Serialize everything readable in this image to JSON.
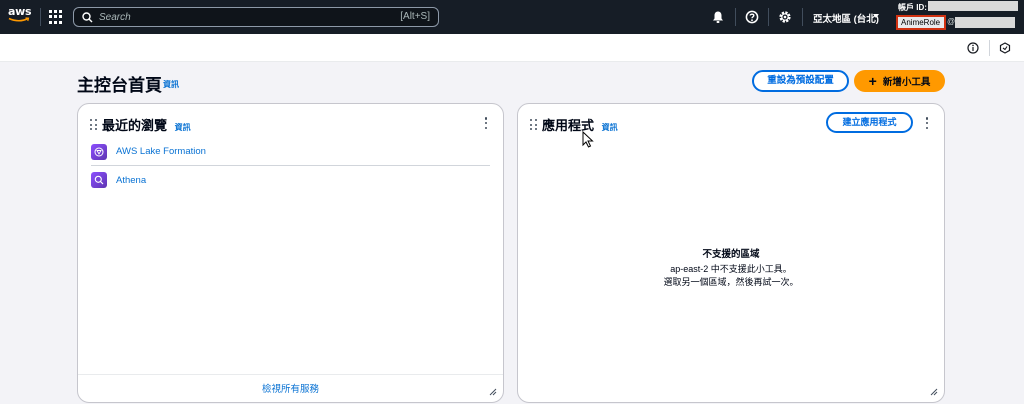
{
  "topnav": {
    "logo_text": "aws",
    "search_placeholder": "Search",
    "search_shortcut": "[Alt+S]",
    "region_label": "亞太地區 (台北)",
    "account_label": "帳戶 ID:",
    "role_name": "AnimeRole",
    "role_at": "@"
  },
  "page": {
    "title": "主控台首頁",
    "info": "資訊",
    "reset_button": "重設為預設配置",
    "add_widget_button": "新增小工具"
  },
  "recent_widget": {
    "title": "最近的瀏覽",
    "info": "資訊",
    "items": [
      {
        "name": "AWS Lake Formation",
        "icon": "lake-formation-icon"
      },
      {
        "name": "Athena",
        "icon": "athena-icon"
      }
    ],
    "footer_link": "檢視所有服務"
  },
  "apps_widget": {
    "title": "應用程式",
    "info": "資訊",
    "create_button": "建立應用程式",
    "empty_title": "不支援的區域",
    "empty_line1": "ap-east-2 中不支援此小工具。",
    "empty_line2": "選取另一個區域，然後再試一次。"
  },
  "colors": {
    "nav_bg": "#161d26",
    "link_blue": "#0972d3",
    "primary_orange": "#ff9900",
    "highlight_red": "#d13212"
  }
}
